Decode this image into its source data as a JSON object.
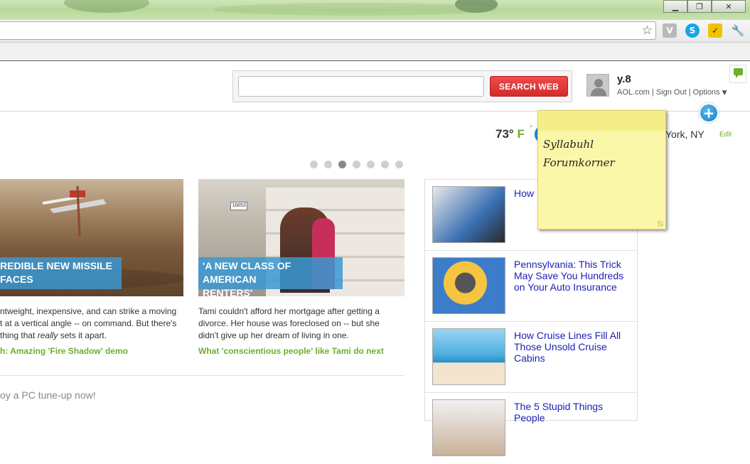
{
  "browser": {
    "window_controls": {
      "minimize": "▁",
      "maximize": "❐",
      "close": "✕"
    },
    "extensions": [
      "v-extension-icon",
      "skype-icon",
      "norton-icon",
      "wrench-icon"
    ]
  },
  "header": {
    "search": {
      "input_value": "",
      "button_label": "SEARCH WEB"
    },
    "user": {
      "name": "y.8",
      "links": {
        "aol": "AOL.com",
        "sep1": " | ",
        "signout": "Sign Out",
        "sep2": " | ",
        "options": "Options"
      }
    }
  },
  "weather": {
    "temp": "73°",
    "unit": "F",
    "city": "York, NY",
    "edit_label": "Edit",
    "star": "*"
  },
  "carousel": {
    "dots": 7,
    "active_index": 2
  },
  "stories": [
    {
      "caption_line1": "REDIBLE NEW MISSILE",
      "caption_line2": "FACES",
      "text_lines": [
        "ntweight, inexpensive, and can strike a moving",
        "t at a vertical angle -- on command. But there's",
        "thing that really sets it apart."
      ],
      "link": "h: Amazing 'Fire Shadow' demo"
    },
    {
      "caption_line1": "'A NEW CLASS OF AMERICAN",
      "caption_line2": "RENTERS'",
      "house_number": "16853",
      "text_lines": [
        "Tami couldn't afford her mortgage after getting a",
        "divorce. Her house was foreclosed on -- but she",
        "didn't give up her dream of living in one."
      ],
      "link": "What 'conscientious people' like Tami do next"
    }
  ],
  "tuneup_text": "oy a PC tune-up now!",
  "ads": [
    {
      "title": "How N for Un"
    },
    {
      "title": "Pennsylvania: This Trick May Save You Hundreds on Your Auto Insurance"
    },
    {
      "title": "How Cruise Lines Fill All Those Unsold Cruise Cabins"
    },
    {
      "title": "The 5 Stupid Things People"
    }
  ],
  "sticky_note": {
    "line1": "Syllabuhl",
    "line2": "Forumkorner"
  },
  "colors": {
    "accent_green": "#6fae2c",
    "search_red": "#e03333",
    "caption_blue": "#3998d2",
    "link_blue": "#1a1fb8"
  }
}
